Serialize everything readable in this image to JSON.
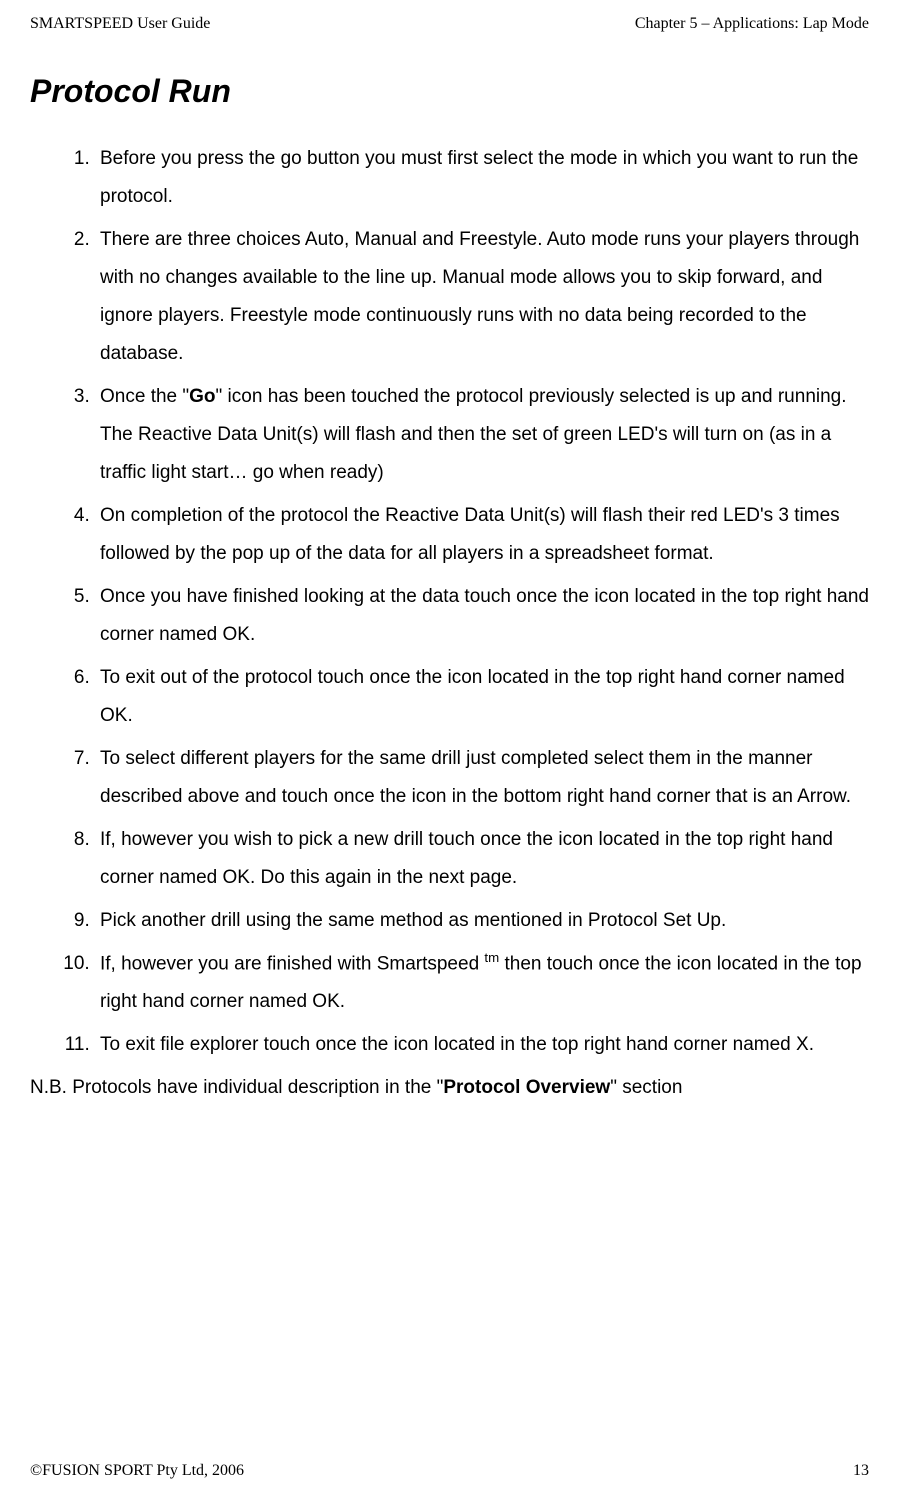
{
  "header": {
    "left": "SMARTSPEED User Guide",
    "right": "Chapter 5 – Applications: Lap Mode"
  },
  "heading": "Protocol Run",
  "items": {
    "item1": "Before you press the go button you must first select the mode in which you want to run the protocol.",
    "item2": "There are three choices Auto, Manual and Freestyle. Auto mode runs your players through with no changes available to the line up. Manual mode allows you to skip forward, and ignore players. Freestyle mode continuously runs with no data being recorded to the database.",
    "item3_pre": "Once the \"",
    "item3_bold": "Go",
    "item3_post": "\" icon has been touched the protocol previously selected is up and running. The Reactive Data Unit(s) will flash and then the set of green LED's will turn on (as in a traffic light start… go when ready)",
    "item4": "On completion of the protocol the Reactive Data Unit(s) will flash their red LED's 3 times followed by the pop up of the data for all players in a spreadsheet format.",
    "item5": "Once you have finished looking at the data touch once the icon located in the top right hand corner named OK.",
    "item6": "To exit out of the protocol touch once the icon located in the top right hand corner named OK.",
    "item7": "To select different players for the same drill just completed select them in the manner described above and touch once the icon in the bottom right hand corner that is an Arrow.",
    "item8": "If, however you wish to pick a new drill touch once the icon located in the top right hand corner named OK. Do this again in the next page.",
    "item9": "Pick another drill using the same method as mentioned in Protocol Set Up.",
    "item10_pre": "If, however you are finished with Smartspeed ",
    "item10_sup": "tm",
    "item10_post": " then touch once the icon located in the top right hand corner named OK.",
    "item11": "To exit file explorer touch once the icon located in the top right hand corner named X."
  },
  "nb": {
    "pre": "N.B. Protocols have individual description in the \"",
    "bold": "Protocol Overview",
    "post": "\" section"
  },
  "footer": {
    "left": "©FUSION SPORT Pty Ltd, 2006",
    "right": "13"
  }
}
